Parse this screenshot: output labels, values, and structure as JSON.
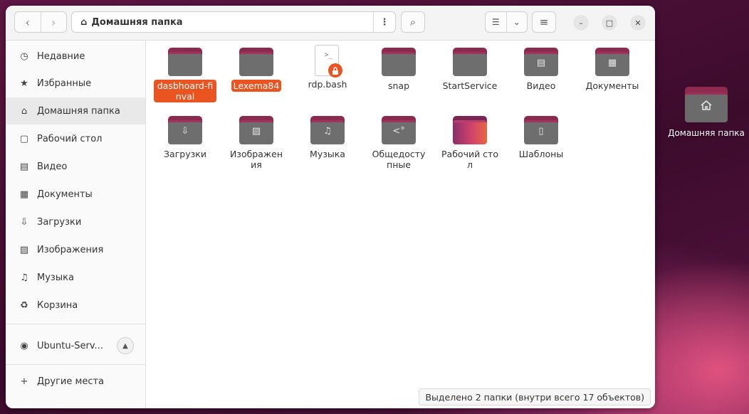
{
  "desktop": {
    "home_icon": "home-folder-icon",
    "home_label": "Домашняя папка"
  },
  "header": {
    "location": "Домашняя папка",
    "back_icon": "‹",
    "forward_icon": "›",
    "location_icon": "⌂",
    "menu_icon": "⋮",
    "search_icon": "⌕",
    "view_list_icon": "☰",
    "view_dropdown_icon": "⌄",
    "main_menu_icon": "≡",
    "minimize_icon": "–",
    "maximize_icon": "□",
    "close_icon": "✕"
  },
  "sidebar": {
    "items": [
      {
        "label": "Недавние",
        "icon": "◷"
      },
      {
        "label": "Избранные",
        "icon": "★"
      },
      {
        "label": "Домашняя папка",
        "icon": "⌂"
      },
      {
        "label": "Рабочий стол",
        "icon": "▢"
      },
      {
        "label": "Видео",
        "icon": "▤"
      },
      {
        "label": "Документы",
        "icon": "▦"
      },
      {
        "label": "Загрузки",
        "icon": "⇩"
      },
      {
        "label": "Изображения",
        "icon": "▨"
      },
      {
        "label": "Музыка",
        "icon": "♫"
      },
      {
        "label": "Корзина",
        "icon": "♻"
      }
    ],
    "drive": {
      "label": "Ubuntu-Serv...",
      "icon": "◉",
      "eject_icon": "▲"
    },
    "other": {
      "label": "Другие места",
      "icon": "+"
    }
  },
  "files": [
    {
      "name": "dasbhoard-finval",
      "selected": true,
      "glyph": ""
    },
    {
      "name": "Lexema84",
      "selected": true,
      "glyph": ""
    },
    {
      "name": "rdp.bash",
      "selected": false,
      "glyph": ">_",
      "lock": "🔒"
    },
    {
      "name": "snap",
      "selected": false,
      "glyph": ""
    },
    {
      "name": "StartService",
      "selected": false,
      "glyph": ""
    },
    {
      "name": "Видео",
      "selected": false,
      "glyph": "▤"
    },
    {
      "name": "Документы",
      "selected": false,
      "glyph": "▦"
    },
    {
      "name": "Загрузки",
      "selected": false,
      "glyph": "⇩"
    },
    {
      "name": "Изображения",
      "selected": false,
      "glyph": "▨"
    },
    {
      "name": "Музыка",
      "selected": false,
      "glyph": "♫"
    },
    {
      "name": "Общедоступные",
      "selected": false,
      "glyph": "<°"
    },
    {
      "name": "Рабочий стол",
      "selected": false,
      "glyph": ""
    },
    {
      "name": "Шаблоны",
      "selected": false,
      "glyph": "▯"
    }
  ],
  "status": "Выделено 2 папки (внутри всего 17 объектов)"
}
